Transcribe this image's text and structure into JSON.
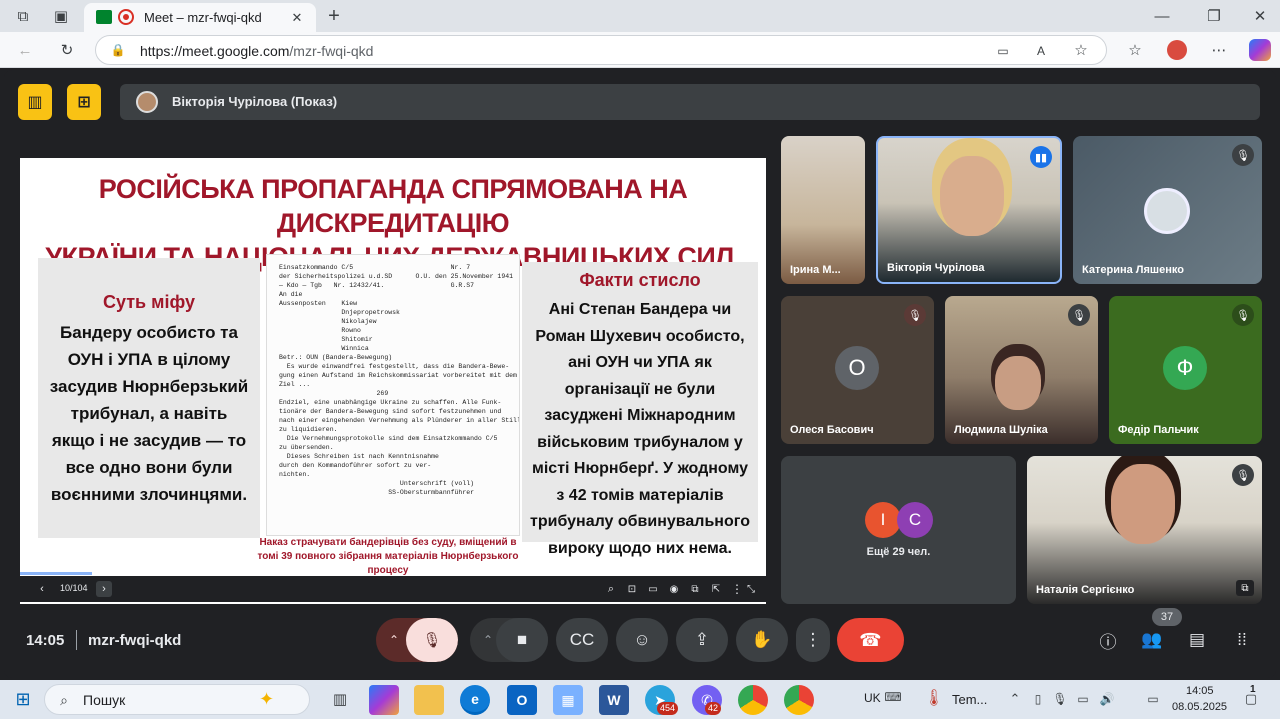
{
  "browser": {
    "tab_title": "Meet – mzr-fwqi-qkd",
    "new_tab": "+",
    "url_host": "https://meet.google.com",
    "url_path": "/mzr-fwqi-qkd"
  },
  "meet": {
    "presenter_chip": "Вікторія Чурілова (Показ)",
    "slide": {
      "title_line1": "РОСІЙСЬКА ПРОПАГАНДА  СПРЯМОВАНА  НА ДИСКРЕДИТАЦІЮ",
      "title_line2": "УКРАЇНИ ТА НАЦІОНАЛЬНИХ ДЕРЖАВНИЦЬКИХ СИЛ.",
      "left_heading": "Суть міфу",
      "left_text": "Бандеру особисто та ОУН і УПА в цілому засудив Нюрнберзький трибунал, а навіть якщо і не засудив — то все одно вони були воєнними злочинцями.",
      "right_heading": "Факти стисло",
      "right_text": "Ані Степан Бандера чи Роман Шухевич особисто, ані ОУН чи УПА як організації не були засуджені Міжнародним військовим трибуналом у місті Нюрнберґ. У жодному з 42 томів матеріалів трибуналу обвинувального вироку щодо них нема.",
      "doc_lines": [
        "Einsatzkommando C/5                         Nr. 7",
        "der Sicherheitspolizei u.d.SD      O.U. den 25.November 1941",
        "— Kdo — Tgb   Nr. 12432/41.                 G.R.S7",
        "An die",
        "Aussenposten    Kiew",
        "                Dnjepropetrowsk",
        "                Nikolajew",
        "                Rowno",
        "                Shitomir",
        "                Winnica",
        "Betr.: OUN (Bandera-Bewegung)",
        "  Es wurde einwandfrei festgestellt, dass die Bandera-Bewe-",
        "gung einen Aufstand im Reichskommissariat vorbereitet mit dem",
        "Ziel ...",
        "                         269",
        "",
        "Endziel, eine unabhängige Ukraine zu schaffen. Alle Funk-",
        "tionäre der Bandera-Bewegung sind sofort festzunehmen und",
        "nach einer eingehenden Vernehmung als Plünderer in aller Stille",
        "zu liquidieren.",
        "  Die Vernehmungsprotokolle sind dem Einsatzkommando C/5",
        "zu übersenden.",
        "  Dieses Schreiben ist nach Kenntnisnahme",
        "durch den Kommandoführer sofort zu ver-",
        "nichten.",
        "                               Unterschrift (voll)",
        "                            SS-Obersturmbannführer"
      ],
      "caption": "Наказ страчувати бандерівців без суду, вміщений в томі 39 повного зібрання матеріалів Нюрнберзького процесу"
    },
    "page_counter": "10/104",
    "participants": [
      {
        "name": "Ірина М..."
      },
      {
        "name": "Вікторія Чурілова"
      },
      {
        "name": "Катерина Ляшенко"
      },
      {
        "name": "Олеся Басович",
        "initial": "О"
      },
      {
        "name": "Людмила Шуліка"
      },
      {
        "name": "Федір Пальчик",
        "initial": "Ф"
      },
      {
        "name": "Наталія Сергієнко"
      }
    ],
    "others": {
      "initials": [
        "І",
        "С"
      ],
      "label": "Ещё 29 чел."
    },
    "time": "14:05",
    "code": "mzr-fwqi-qkd",
    "people_count": "37",
    "colors": {
      "accent_yellow": "#f9c214",
      "end_call": "#ea4335",
      "mic_off": "#f9dedc",
      "olesia": "#5f6368",
      "fedir": "#34a853",
      "i_avatar": "#e8542f",
      "c_avatar": "#8e3fb3"
    }
  },
  "taskbar": {
    "search": "Пошук",
    "lang": "UK",
    "weather": "Tem...",
    "clock_time": "14:05",
    "clock_date": "08.05.2025",
    "badge_telegram": "454",
    "badge_viber": "42",
    "notif_count": "1"
  }
}
